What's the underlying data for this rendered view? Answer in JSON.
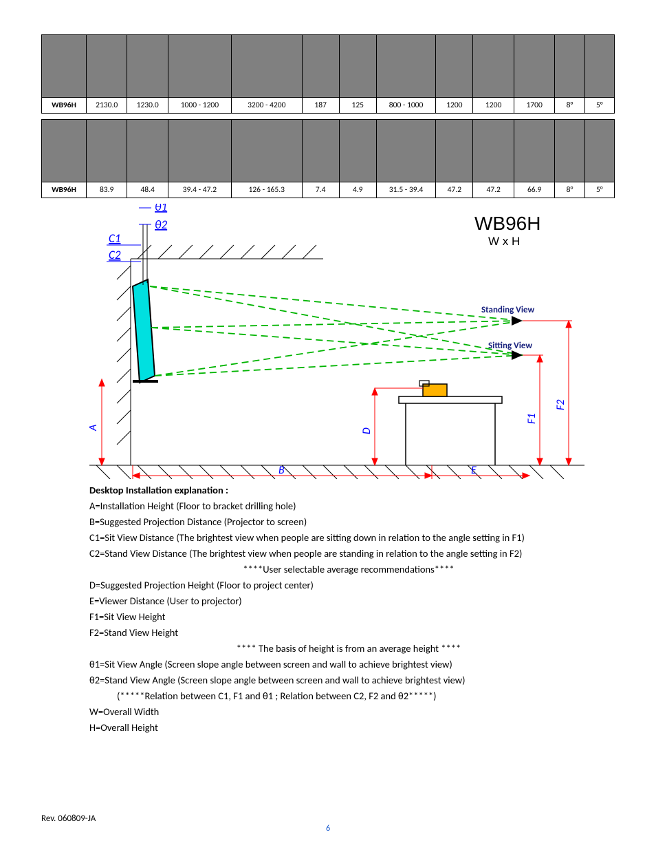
{
  "table1": {
    "label": "WB96H",
    "cells": [
      "2130.0",
      "1230.0",
      "1000 - 1200",
      "3200 - 4200",
      "187",
      "125",
      "800 - 1000",
      "1200",
      "1200",
      "1700",
      "8°",
      "5°"
    ]
  },
  "table2": {
    "label": "WB96H",
    "cells": [
      "83.9",
      "48.4",
      "39.4 - 47.2",
      "126 - 165.3",
      "7.4",
      "4.9",
      "31.5 - 39.4",
      "47.2",
      "47.2",
      "66.9",
      "8°",
      "5°"
    ]
  },
  "diagram": {
    "theta1": "θ1",
    "theta2": "θ2",
    "c1": "C1",
    "c2": "C2",
    "a": "A",
    "b": "B",
    "d": "D",
    "e": "E",
    "f1": "F1",
    "f2": "F2",
    "title": "WB96H",
    "subtitle": "W x H",
    "standing": "Standing View",
    "sitting": "Sitting View"
  },
  "body": {
    "hdr": "Desktop Installation explanation :",
    "l1": "A=Installation Height (Floor to bracket drilling hole)",
    "l2": "B=Suggested Projection Distance (Projector to screen)",
    "l3": "C1=Sit View Distance (The brightest view when people are sitting down in relation to the angle setting in F1)",
    "l4": "C2=Stand View Distance (The brightest view when people are standing in relation to the angle setting in F2)",
    "l5": "****User selectable average recommendations****",
    "l6": "D=Suggested Projection Height (Floor to project center)",
    "l7": "E=Viewer Distance (User to projector)",
    "l8": "F1=Sit View Height",
    "l9": "F2=Stand View Height",
    "l10": "**** The basis of height is from an average height ****",
    "l11": "θ1=Sit View Angle (Screen slope angle between screen and wall to achieve brightest view)",
    "l12": "θ2=Stand View Angle (Screen slope angle between screen and wall to achieve brightest view)",
    "l13": "(*****Relation between C1, F1 and θ1 ; Relation between C2, F2 and θ2*****)",
    "l14": "W=Overall Width",
    "l15": "H=Overall Height"
  },
  "footer": "Rev. 060809-JA",
  "pagenum": "6"
}
